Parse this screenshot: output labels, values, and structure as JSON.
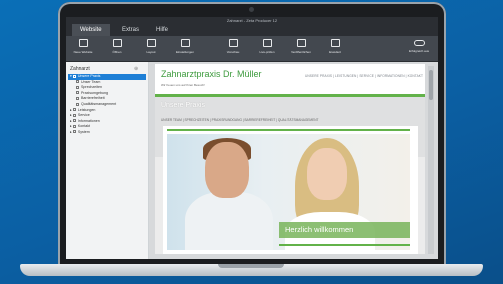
{
  "window": {
    "title": "Zahnarzt - Zeta Producer 12"
  },
  "tabs": [
    {
      "label": "Website"
    },
    {
      "label": "Extras"
    },
    {
      "label": "Hilfe"
    }
  ],
  "ribbon": [
    {
      "label": "Neue Website",
      "icon": "folder-icon"
    },
    {
      "label": "Öffnen",
      "icon": "open-icon"
    },
    {
      "label": "Layout",
      "icon": "layout-icon"
    },
    {
      "label": "Einstellungen",
      "icon": "settings-icon"
    },
    {
      "label": "Vorschau",
      "icon": "preview-icon"
    },
    {
      "label": "Live-prüfen",
      "icon": "live-icon"
    },
    {
      "label": "Veröffentlichen",
      "icon": "publish-icon"
    },
    {
      "label": "Erweitert",
      "icon": "extend-icon"
    },
    {
      "label": "Erfolgreich aus",
      "icon": "toggle-icon"
    }
  ],
  "sidebar": {
    "title": "Zahnarzt",
    "items": [
      {
        "label": "Unsere Praxis",
        "selected": true
      },
      {
        "label": "Unser Team",
        "selected": false
      },
      {
        "label": "Sprechzeiten",
        "selected": false
      },
      {
        "label": "Praxisumgebung",
        "selected": false
      },
      {
        "label": "Barrierefreiheit",
        "selected": false
      },
      {
        "label": "Qualitätsmanagement",
        "selected": false
      },
      {
        "label": "Leistungen",
        "selected": false
      },
      {
        "label": "Service",
        "selected": false
      },
      {
        "label": "Informationen",
        "selected": false
      },
      {
        "label": "Kontakt",
        "selected": false
      },
      {
        "label": "System",
        "selected": false
      }
    ]
  },
  "site": {
    "logo": "Zahnarztpraxis Dr. Müller",
    "tagline": "Wir freuen uns auf Ihren Besuch!",
    "topnav": "UNSERE PRAXIS | LEISTUNGEN | SERVICE | INFORMATIONEN | KONTAKT",
    "page_title": "Unsere Praxis",
    "subnav": "UNSER TEAM | SPRECHZEITEN | PRAXISRUNDGANG | BARRIEREFREIHEIT | QUALITÄTSMANAGEMENT",
    "welcome": "Herzlich willkommen"
  },
  "colors": {
    "accent": "#63b24a",
    "selection": "#1e7fd6",
    "background": "#0b5fa3"
  }
}
